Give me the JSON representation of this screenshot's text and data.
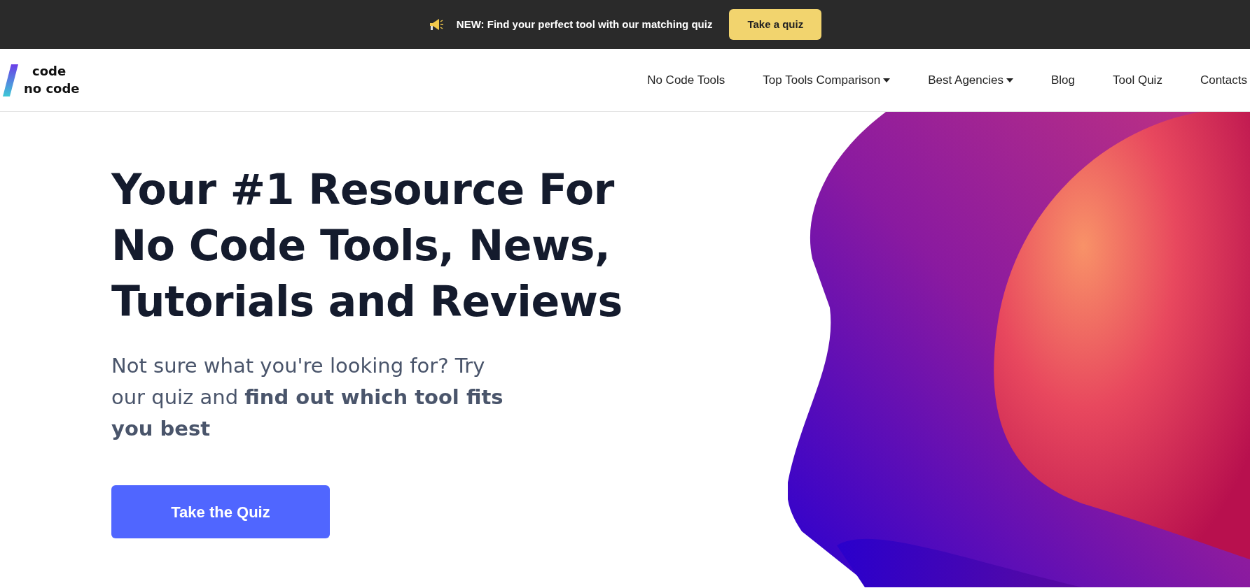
{
  "announcement": {
    "label": "NEW:",
    "text": "Find your perfect tool with our matching quiz",
    "button": "Take a quiz"
  },
  "logo": {
    "line_1": "code",
    "line_2": "no code"
  },
  "nav": [
    {
      "label": "No Code Tools",
      "dropdown": false
    },
    {
      "label": "Top Tools Comparison",
      "dropdown": true
    },
    {
      "label": "Best Agencies",
      "dropdown": true
    },
    {
      "label": "Blog",
      "dropdown": false
    },
    {
      "label": "Tool Quiz",
      "dropdown": false
    },
    {
      "label": "Contacts",
      "dropdown": false
    }
  ],
  "hero": {
    "title": "Your #1 Resource For No Code Tools, News, Tutorials and Reviews",
    "subtitle": "Not sure what you're looking for? Try our quiz and **find out which tool fits you best**",
    "button": "Take the Quiz"
  }
}
